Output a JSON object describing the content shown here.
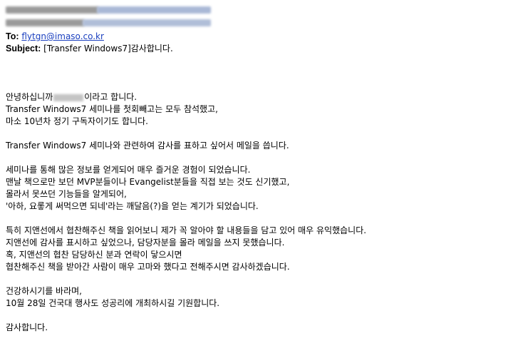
{
  "header": {
    "to_label": "To:",
    "to_address": "flytgn@imaso.co.kr",
    "subject_label": "Subject:",
    "subject_value": "[Transfer Windows7]감사합니다."
  },
  "body": {
    "greeting_prefix": "안녕하십니까",
    "greeting_suffix": "이라고 합니다.",
    "p1": [
      "Transfer Windows7 세미나를 첫회빼고는 모두 참석했고,",
      "마소 10년차 정기 구독자이기도 합니다."
    ],
    "p2": [
      "Transfer Windows7 세미나와 관련하여 감사를 표하고 싶어서 메일을 씁니다."
    ],
    "p3": [
      "세미나를 통해 많은 정보를 얻게되어 매우 즐거운 경험이 되었습니다.",
      "맨날 책으로만 보던 MVP분들이나 Evangelist분들을 직접 보는 것도 신기했고,",
      "몰라서 못쓰던 기능들을 알게되어,",
      "'아하, 요롷게 써먹으면 되네'라는 깨달음(?)을 얻는 계기가 되었습니다."
    ],
    "p4": [
      "특히 지앤선에서 협찬해주신 책을 읽어보니 제가 꼭 알아야 할 내용들을 담고 있어 매우 유익했습니다.",
      "지앤선에 감사를 표시하고 싶었으나, 담당자분을 몰라 메일을 쓰지 못했습니다.",
      "혹, 지앤선의 협찬 담당하신 분과 연락이 닿으시면",
      "협찬해주신 책을 받아간 사람이 매우 고마와 했다고 전해주시면 감사하겠습니다."
    ],
    "p5": [
      "건강하시기를 바라며,",
      "10월 28일 건국대 행사도 성공리에 개최하시길 기원합니다."
    ],
    "closing": "감사합니다."
  }
}
